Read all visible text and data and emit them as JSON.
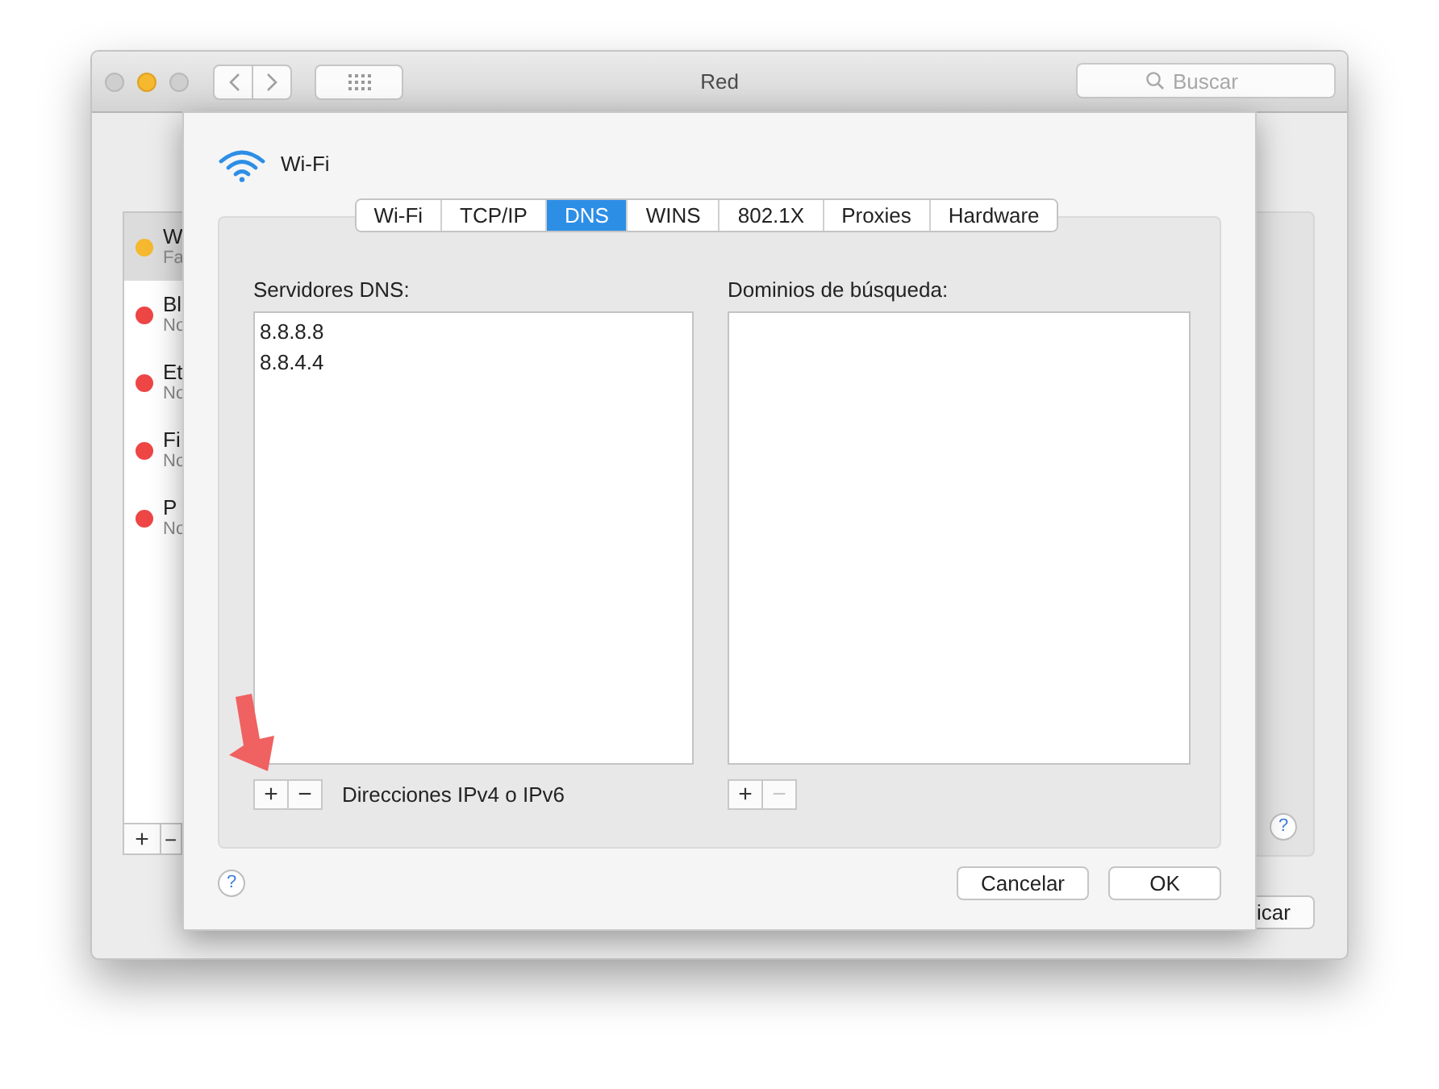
{
  "window": {
    "title": "Red",
    "search": {
      "placeholder": "Buscar"
    },
    "help": "?",
    "apply_button": "icar"
  },
  "sidebar": {
    "items": [
      {
        "name": "W",
        "status": "Fa",
        "color": "#f5b82e",
        "selected": true
      },
      {
        "name": "Bl",
        "status": "No",
        "color": "#ee4545",
        "selected": false
      },
      {
        "name": "Et",
        "status": "No",
        "color": "#ee4545",
        "selected": false
      },
      {
        "name": "Fi",
        "status": "No",
        "color": "#ee4545",
        "selected": false
      },
      {
        "name": "P",
        "status": "No",
        "color": "#ee4545",
        "selected": false
      }
    ],
    "add": "+",
    "remove": "−"
  },
  "sheet": {
    "service": "Wi-Fi",
    "tabs": [
      {
        "label": "Wi-Fi",
        "selected": false
      },
      {
        "label": "TCP/IP",
        "selected": false
      },
      {
        "label": "DNS",
        "selected": true
      },
      {
        "label": "WINS",
        "selected": false
      },
      {
        "label": "802.1X",
        "selected": false
      },
      {
        "label": "Proxies",
        "selected": false
      },
      {
        "label": "Hardware",
        "selected": false
      }
    ],
    "dns_servers": {
      "label": "Servidores DNS:",
      "entries": [
        "8.8.8.8",
        "8.8.4.4"
      ],
      "add": {
        "label": "+",
        "disabled": false
      },
      "remove": {
        "label": "−",
        "disabled": false
      },
      "hint": "Direcciones IPv4 o IPv6"
    },
    "search_domains": {
      "label": "Dominios de búsqueda:",
      "add": {
        "label": "+",
        "disabled": false
      },
      "remove": {
        "label": "−",
        "disabled": true
      }
    },
    "help": "?",
    "buttons": [
      "Cancelar",
      "OK"
    ]
  }
}
